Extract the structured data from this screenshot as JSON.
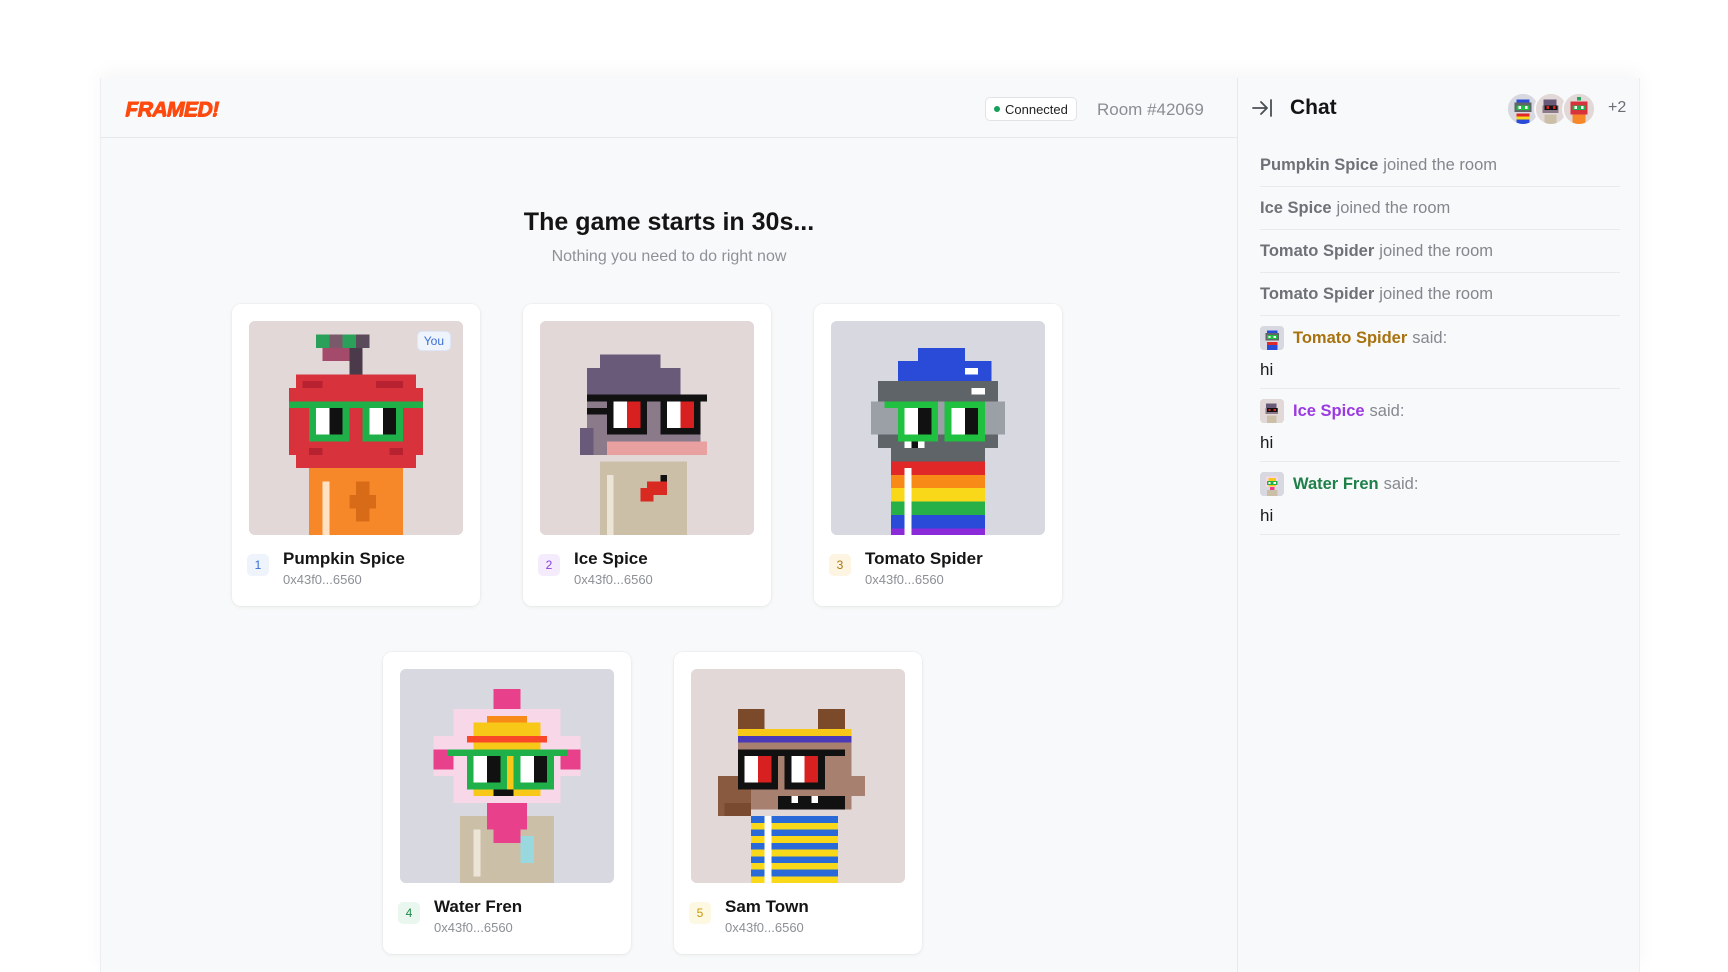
{
  "header": {
    "logo_text": "FRAMED!",
    "status_label": "Connected",
    "room_label": "Room #42069"
  },
  "main": {
    "title": "The game starts in 30s...",
    "subtitle": "Nothing you need to do right now"
  },
  "players": [
    {
      "rank": "1",
      "name": "Pumpkin Spice",
      "address": "0x43f0...6560",
      "you_label": "You",
      "avatar": "apple-head-avatar",
      "rank_color": "#3a6fd6",
      "rank_bg": "#eef3fc"
    },
    {
      "rank": "2",
      "name": "Ice Spice",
      "address": "0x43f0...6560",
      "avatar": "purple-hair-avatar",
      "rank_color": "#8b3fd9",
      "rank_bg": "#f4ecfd"
    },
    {
      "rank": "3",
      "name": "Tomato Spider",
      "address": "0x43f0...6560",
      "avatar": "helmet-rainbow-avatar",
      "rank_color": "#a87412",
      "rank_bg": "#fdf4e2"
    },
    {
      "rank": "4",
      "name": "Water Fren",
      "address": "0x43f0...6560",
      "avatar": "flower-head-avatar",
      "rank_color": "#1e8a4c",
      "rank_bg": "#e9f7ef"
    },
    {
      "rank": "5",
      "name": "Sam Town",
      "address": "0x43f0...6560",
      "avatar": "dog-head-avatar",
      "rank_color": "#c79a0a",
      "rank_bg": "#fdf8e1"
    }
  ],
  "chat": {
    "title": "Chat",
    "more_count": "+2",
    "events": [
      {
        "user": "Pumpkin Spice",
        "text": "joined the room"
      },
      {
        "user": "Ice Spice",
        "text": "joined the room"
      },
      {
        "user": "Tomato Spider",
        "text": "joined the room"
      },
      {
        "user": "Tomato Spider",
        "text": "joined the room"
      }
    ],
    "messages": [
      {
        "user": "Tomato Spider",
        "said": "said:",
        "body": "hi",
        "color": "#a8720f"
      },
      {
        "user": "Ice Spice",
        "said": "said:",
        "body": "hi",
        "color": "#9b3ae0"
      },
      {
        "user": "Water Fren",
        "said": "said:",
        "body": "hi",
        "color": "#1e7f49"
      }
    ]
  }
}
